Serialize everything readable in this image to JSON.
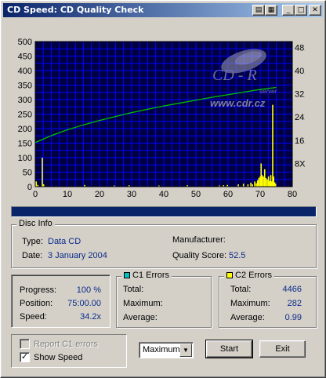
{
  "window": {
    "title": "CD Speed: CD Quality Check",
    "buttons": [
      "book-icon",
      "save-icon",
      "minimize-icon",
      "maximize-icon",
      "close-icon"
    ]
  },
  "chart_data": {
    "type": "bar",
    "title": "",
    "xlabel": "",
    "ylabel": "",
    "xlim": [
      0,
      80
    ],
    "ylim": [
      0,
      500
    ],
    "y2lim": [
      0,
      50
    ],
    "x_ticks": [
      "0",
      "10",
      "20",
      "30",
      "40",
      "50",
      "60",
      "70",
      "80"
    ],
    "y_ticks": [
      "0",
      "50",
      "100",
      "150",
      "200",
      "250",
      "300",
      "350",
      "400",
      "450",
      "500"
    ],
    "y2_ticks": [
      "8X",
      "16X",
      "24X",
      "32X",
      "40X",
      "48X"
    ],
    "y2_tick_values": [
      8,
      16,
      24,
      32,
      40,
      48
    ],
    "grid": true,
    "colors": {
      "background": "#000040",
      "grid": "#0000ff",
      "errors": "#ffff00",
      "speed": "#00c000"
    },
    "c2_errors": [
      {
        "x": 0.3,
        "y": 18
      },
      {
        "x": 0.8,
        "y": 6
      },
      {
        "x": 2.2,
        "y": 100
      },
      {
        "x": 2.6,
        "y": 8
      },
      {
        "x": 15.4,
        "y": 6
      },
      {
        "x": 24.6,
        "y": 4
      },
      {
        "x": 29.2,
        "y": 5
      },
      {
        "x": 38.5,
        "y": 4
      },
      {
        "x": 47.3,
        "y": 5
      },
      {
        "x": 57.3,
        "y": 4
      },
      {
        "x": 58.6,
        "y": 5
      },
      {
        "x": 59.8,
        "y": 6
      },
      {
        "x": 63.2,
        "y": 8
      },
      {
        "x": 64.8,
        "y": 10
      },
      {
        "x": 66.2,
        "y": 8
      },
      {
        "x": 67.1,
        "y": 14
      },
      {
        "x": 67.6,
        "y": 8
      },
      {
        "x": 68.3,
        "y": 18
      },
      {
        "x": 68.8,
        "y": 12
      },
      {
        "x": 69.2,
        "y": 22
      },
      {
        "x": 69.6,
        "y": 30
      },
      {
        "x": 70.0,
        "y": 35
      },
      {
        "x": 70.3,
        "y": 80
      },
      {
        "x": 70.6,
        "y": 40
      },
      {
        "x": 71.0,
        "y": 35
      },
      {
        "x": 71.4,
        "y": 60
      },
      {
        "x": 71.8,
        "y": 30
      },
      {
        "x": 72.2,
        "y": 25
      },
      {
        "x": 72.6,
        "y": 35
      },
      {
        "x": 73.0,
        "y": 20
      },
      {
        "x": 73.3,
        "y": 40
      },
      {
        "x": 73.6,
        "y": 18
      },
      {
        "x": 73.9,
        "y": 282
      },
      {
        "x": 74.2,
        "y": 35
      },
      {
        "x": 74.5,
        "y": 15
      },
      {
        "x": 74.8,
        "y": 10
      }
    ],
    "speed": {
      "x": [
        0,
        5,
        10,
        15,
        20,
        25,
        30,
        35,
        40,
        45,
        50,
        55,
        60,
        65,
        70,
        75
      ],
      "y": [
        15.2,
        17.6,
        19.6,
        21.3,
        22.8,
        24.2,
        25.5,
        26.7,
        27.8,
        28.8,
        29.8,
        30.8,
        31.7,
        32.6,
        33.5,
        34.2
      ]
    }
  },
  "watermark": {
    "line1": "CD - R",
    "line2": "server",
    "line3": "www.cdr.cz"
  },
  "progress_bar": {
    "fraction": 1.0
  },
  "disc_info": {
    "title": "Disc Info",
    "type_label": "Type:",
    "type_value": "Data CD",
    "date_label": "Date:",
    "date_value": "3 January 2004",
    "manufacturer_label": "Manufacturer:",
    "manufacturer_value": "",
    "quality_label": "Quality Score:",
    "quality_value": "52.5"
  },
  "status": {
    "progress_label": "Progress:",
    "progress_value": "100 %",
    "position_label": "Position:",
    "position_value": "75:00.00",
    "speed_label": "Speed:",
    "speed_value": "34.2x"
  },
  "c1": {
    "title": "C1 Errors",
    "color": "#00c0c0",
    "total_label": "Total:",
    "total_value": "",
    "max_label": "Maximum:",
    "max_value": "",
    "avg_label": "Average:",
    "avg_value": ""
  },
  "c2": {
    "title": "C2 Errors",
    "color": "#ffff00",
    "total_label": "Total:",
    "total_value": "4466",
    "max_label": "Maximum:",
    "max_value": "282",
    "avg_label": "Average:",
    "avg_value": "0.99"
  },
  "options": {
    "report_c1_label": "Report C1 errors",
    "report_c1_checked": false,
    "report_c1_enabled": false,
    "show_speed_label": "Show Speed",
    "show_speed_checked": true,
    "dropdown_value": "Maximum",
    "start_label": "Start",
    "exit_label": "Exit"
  }
}
